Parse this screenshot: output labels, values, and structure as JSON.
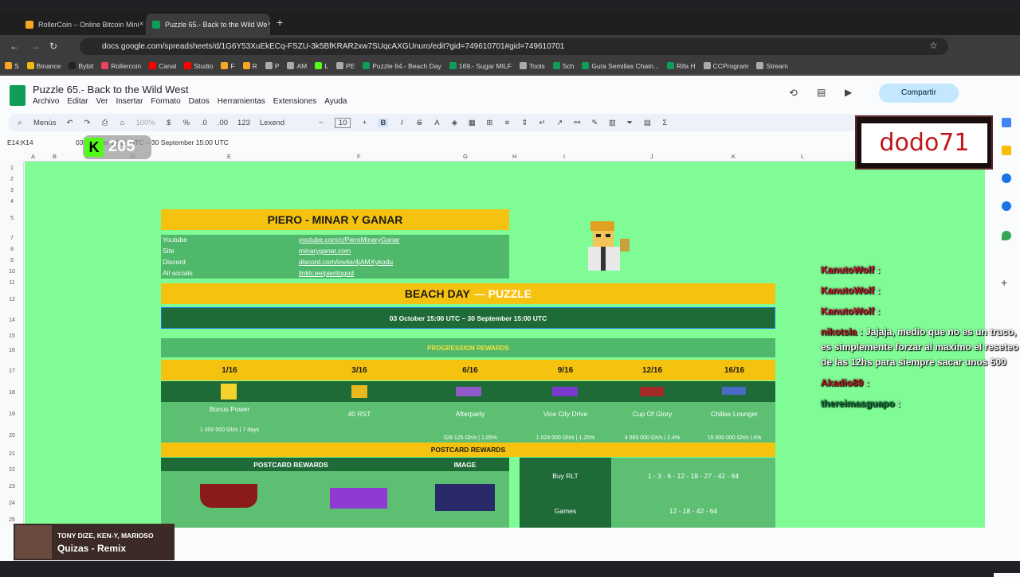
{
  "browser": {
    "tabs": [
      {
        "label": "RollerCoin – Online Bitcoin Mini",
        "close": "×"
      },
      {
        "label": "Puzzle 65.- Back to the Wild We",
        "close": "×"
      }
    ],
    "new_tab": "+",
    "url": "docs.google.com/spreadsheets/d/1G6Y53XuEkECq-FSZU-3k5BfKRAR2xw7SUqcAXGUnuro/edit?gid=749610701#gid=749610701",
    "bookmarks": [
      "S",
      "Binance",
      "Bybit",
      "Rollercoin",
      "Canal",
      "Studio",
      "F",
      "R",
      "P",
      "AM",
      "L",
      "PE",
      "Puzzle 64.- Beach Day",
      "169.- Sugar MILF",
      "Tools",
      "Sch",
      "Guía Semillas Chain...",
      "Rifa H",
      "CCProgram",
      "Stream"
    ]
  },
  "sheets": {
    "title": "Puzzle 65.- Back to the Wild West",
    "menu": [
      "Archivo",
      "Editar",
      "Ver",
      "Insertar",
      "Formato",
      "Datos",
      "Herramientas",
      "Extensiones",
      "Ayuda"
    ],
    "share_label": "Compartir",
    "toolbar": {
      "menus": "Menús",
      "zoom": "100%",
      "currency": "$",
      "percent": "%",
      "dec_minus": ".0",
      "dec_plus": ".00",
      "num_format": "123",
      "font": "Lexend",
      "font_size": "10",
      "bold": "B",
      "italic": "I",
      "strike": "S",
      "textcolor": "A",
      "sum": "Σ"
    },
    "cell_ref": "E14:K14",
    "formula": "03 October 15:00 UTC – 30 September 15:00 UTC",
    "columns": [
      "A",
      "B",
      "C",
      "D",
      "E",
      "F",
      "G",
      "H",
      "I",
      "J",
      "K",
      "L",
      "M",
      "N"
    ],
    "rows": [
      "1",
      "2",
      "3",
      "4",
      "5",
      "7",
      "8",
      "9",
      "10",
      "11",
      "12",
      "14",
      "15",
      "16",
      "17",
      "18",
      "19",
      "20",
      "21",
      "22",
      "23",
      "24",
      "25"
    ]
  },
  "content": {
    "header": "PIERO - MINAR Y GANAR",
    "socials": [
      {
        "name": "Youtube",
        "link": "youtube.com/c/PieroMinaryGanar"
      },
      {
        "name": "Site",
        "link": "minaryganar.com"
      },
      {
        "name": "Discord",
        "link": "discord.com/invite/4jAMXykodu"
      },
      {
        "name": "All socials",
        "link": "linktr.ee/pieritogod"
      }
    ],
    "puzzle_title_a": "BEACH DAY",
    "puzzle_title_b": "— PUZZLE",
    "date_range": "03 October 15:00 UTC – 30 September 15:00 UTC",
    "progression_title": "PROGRESSION REWARDS",
    "progression": [
      {
        "step": "1/16",
        "name": "Bonus Power",
        "value": "1 000 000 Gh/s | 7 days"
      },
      {
        "step": "3/16",
        "name": "40 RST",
        "value": ""
      },
      {
        "step": "6/16",
        "name": "Afterparty",
        "value": "328 125 Gh/s | 1.05%"
      },
      {
        "step": "9/16",
        "name": "Vice City Drive",
        "value": "1 024 000 Gh/s | 1.25%"
      },
      {
        "step": "12/16",
        "name": "Cup Of Glory",
        "value": "4 069 000 Gh/s | 2.4%"
      },
      {
        "step": "16/16",
        "name": "Chillax Lounger",
        "value": "15 000 000 Gh/s | 4%"
      }
    ],
    "postcard_title": "POSTCARD REWARDS",
    "postcard_header": "POSTCARD REWARDS",
    "image_header": "IMAGE",
    "buy_rlt_label": "Buy RLT",
    "buy_rlt_value": "1 - 3 - 6 - 12 - 18 - 27 - 42 - 64",
    "games_label": "Games",
    "games_value": "12 - 18 - 42 - 64"
  },
  "overlay": {
    "streamer": "dodo71",
    "kick_count": "205",
    "kick_letter": "K",
    "chat": [
      {
        "user": "KanutoWolf",
        "msg": ""
      },
      {
        "user": "KanutoWolf",
        "msg": ""
      },
      {
        "user": "KanutoWolf",
        "msg": ""
      },
      {
        "user": "nikotsla",
        "msg": "Jajaja, medio que no es un truco, es simplemente forzar al maximo el reseteo de las 12hs para siempre sacar unos 500"
      },
      {
        "user": "Akadio89",
        "msg": ""
      },
      {
        "user": "thereimasguapo",
        "msg": ""
      }
    ],
    "music_artist": "TONY DIZE, KEN-Y, MARIOSO",
    "music_song": "Quizas - Remix"
  }
}
